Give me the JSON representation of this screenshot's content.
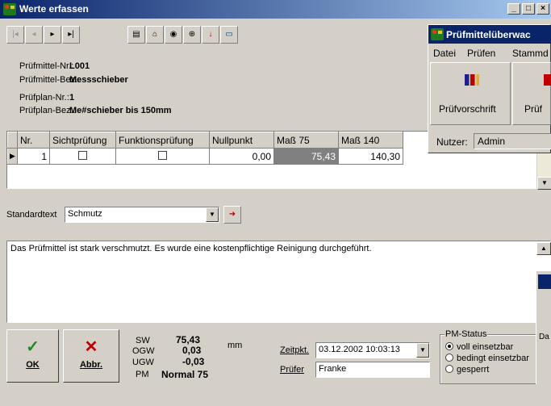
{
  "window": {
    "title": "Werte erfassen",
    "caption_buttons": [
      "_",
      "□",
      "×"
    ]
  },
  "toolbar": {
    "icons": [
      "first-record-icon",
      "prev-record-icon",
      "next-record-icon",
      "last-record-icon",
      "document-icon",
      "folder-icon",
      "camera-icon",
      "zoom-icon",
      "arrow-down-icon",
      "keyboard-icon"
    ]
  },
  "info": {
    "pm_nr_label": "Prüfmittel-Nr.:",
    "pm_nr": "L001",
    "pm_bez_label": "Prüfmittel-Bez.:",
    "pm_bez": "Messschieber",
    "pp_nr_label": "Prüfplan-Nr.:",
    "pp_nr": "1",
    "pp_bez_label": "Prüfplan-Bez.:",
    "pp_bez": "Me#schieber bis 150mm"
  },
  "grid": {
    "headers": [
      "Nr.",
      "Sichtprüfung",
      "Funktionsprüfung",
      "Nullpunkt",
      "Maß 75",
      "Maß 140"
    ],
    "row": {
      "nr": "1",
      "nullpunkt": "0,00",
      "mass75": "75,43",
      "mass140": "140,30"
    }
  },
  "standardtext": {
    "label": "Standardtext",
    "value": "Schmutz"
  },
  "memo": "Das Prüfmittel ist stark verschmutzt. Es wurde eine kostenpflichtige Reinigung durchgeführt.",
  "buttons": {
    "ok": "OK",
    "abbr": "Abbr."
  },
  "stats": {
    "sw_label": "SW",
    "sw": "75,43",
    "unit": "mm",
    "ogw_label": "OGW",
    "ogw": "0,03",
    "ugw_label": "UGW",
    "ugw": "-0,03",
    "pm_label": "PM",
    "pm": "Normal 75"
  },
  "zeitpkt": {
    "label": "Zeitpkt.",
    "value": "03.12.2002 10:03:13"
  },
  "pruefer": {
    "label": "Prüfer",
    "value": "Franke"
  },
  "pm_status": {
    "label": "PM-Status",
    "options": [
      "voll einsetzbar",
      "bedingt einsetzbar",
      "gesperrt"
    ],
    "selected": "voll einsetzbar"
  },
  "overlay": {
    "title": "Prüfmittelüberwac",
    "menu": [
      "Datei",
      "Prüfen",
      "Stammd"
    ],
    "btn1": "Prüfvorschrift",
    "btn2": "Prüf",
    "user_label": "Nutzer:",
    "user": "Admin",
    "partial_text": "Da"
  }
}
